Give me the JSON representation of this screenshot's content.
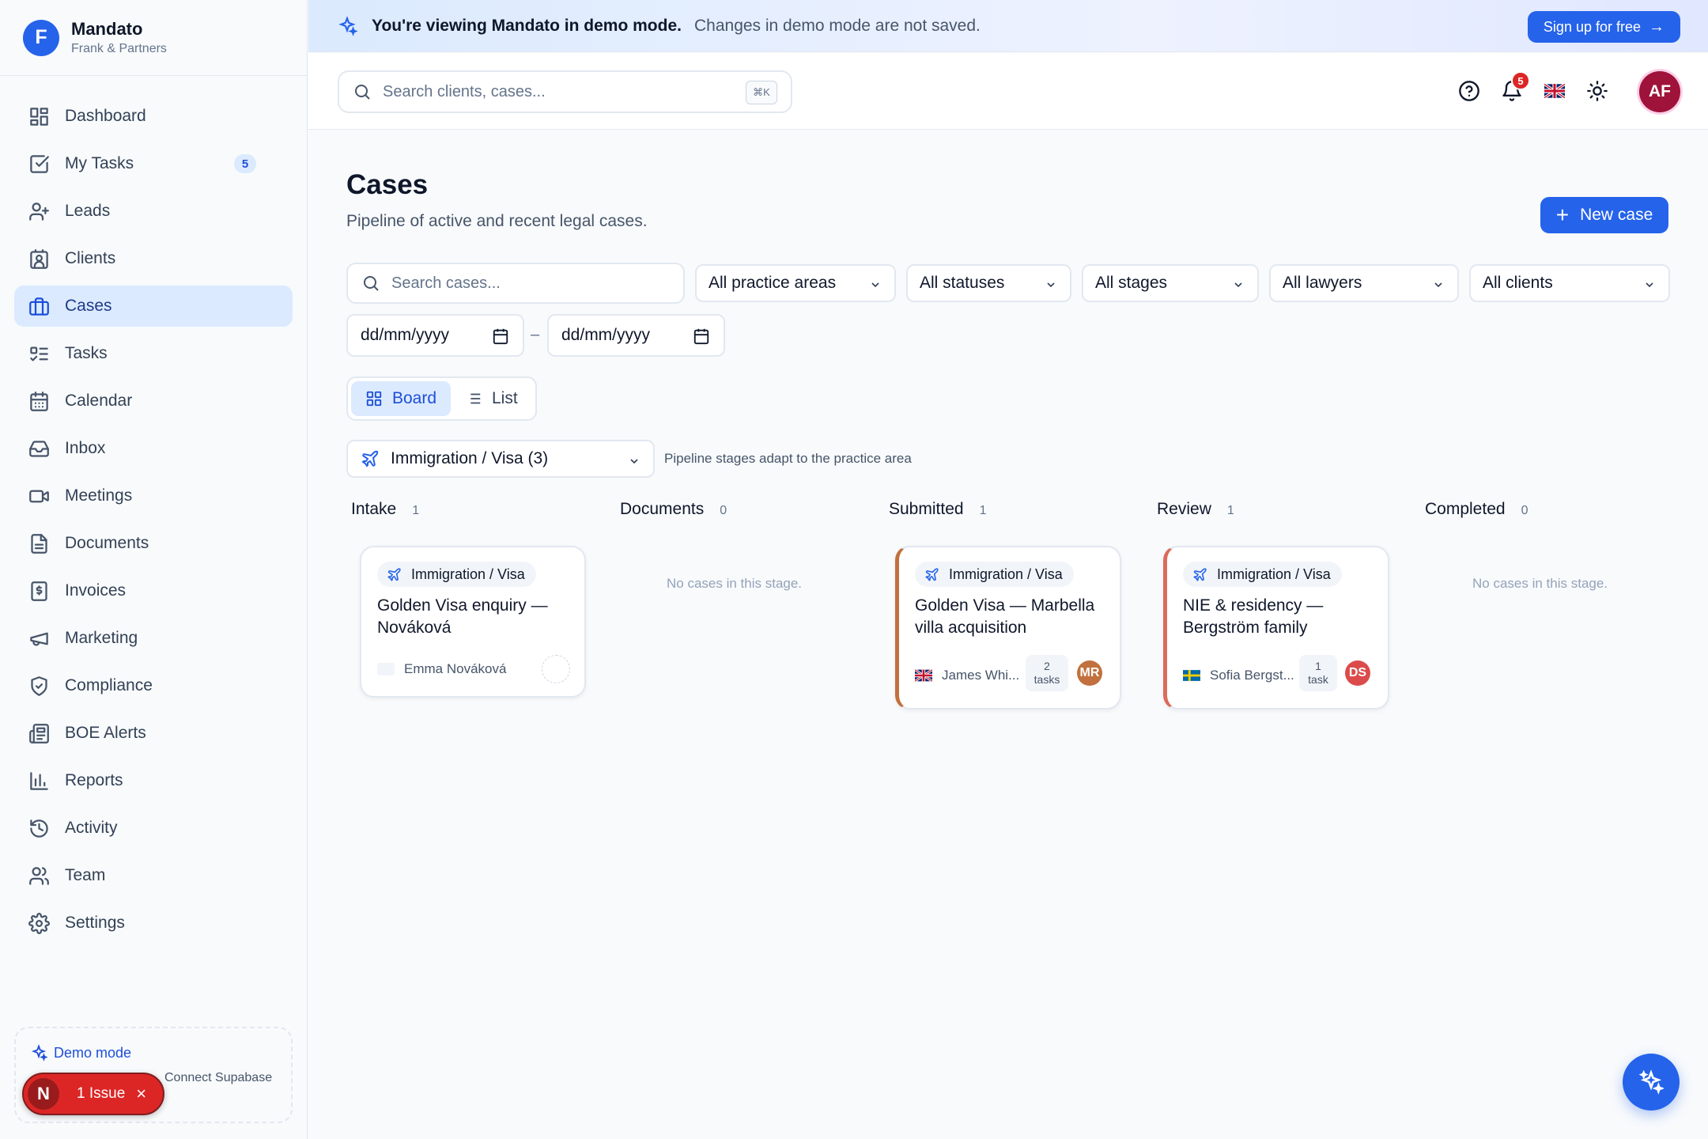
{
  "brand": {
    "initial": "F",
    "name": "Mandato",
    "firm": "Frank & Partners"
  },
  "sidebar": {
    "items": [
      {
        "label": "Dashboard",
        "icon": "dashboard-icon"
      },
      {
        "label": "My Tasks",
        "icon": "checkbox-icon",
        "badge": "5"
      },
      {
        "label": "Leads",
        "icon": "user-plus-icon"
      },
      {
        "label": "Clients",
        "icon": "contact-icon"
      },
      {
        "label": "Cases",
        "icon": "briefcase-icon",
        "active": true
      },
      {
        "label": "Tasks",
        "icon": "list-todo-icon"
      },
      {
        "label": "Calendar",
        "icon": "calendar-icon"
      },
      {
        "label": "Inbox",
        "icon": "inbox-icon"
      },
      {
        "label": "Meetings",
        "icon": "video-icon"
      },
      {
        "label": "Documents",
        "icon": "file-icon"
      },
      {
        "label": "Invoices",
        "icon": "invoice-icon"
      },
      {
        "label": "Marketing",
        "icon": "megaphone-icon"
      },
      {
        "label": "Compliance",
        "icon": "shield-icon"
      },
      {
        "label": "BOE Alerts",
        "icon": "newspaper-icon"
      },
      {
        "label": "Reports",
        "icon": "bar-chart-icon"
      },
      {
        "label": "Activity",
        "icon": "history-icon"
      },
      {
        "label": "Team",
        "icon": "users-icon"
      },
      {
        "label": "Settings",
        "icon": "gear-icon"
      }
    ],
    "demo": {
      "title": "Demo mode",
      "connect": "Connect Supabase"
    },
    "issue": {
      "initial": "N",
      "label": "1 Issue"
    }
  },
  "banner": {
    "strong": "You're viewing Mandato in demo mode.",
    "soft": "Changes in demo mode are not saved.",
    "signup": "Sign up for free"
  },
  "header": {
    "search_placeholder": "Search clients, cases...",
    "shortcut": "⌘K",
    "notifications": "5",
    "avatar": "AF"
  },
  "main": {
    "title": "Cases",
    "subtitle": "Pipeline of active and recent legal cases.",
    "new_case": "New case",
    "search_placeholder": "Search cases...",
    "filters": [
      "All practice areas",
      "All statuses",
      "All stages",
      "All lawyers",
      "All clients"
    ],
    "date_placeholder": "dd/mm/yyyy",
    "date_sep": "–",
    "view": {
      "board": "Board",
      "list": "List"
    },
    "practice_area": "Immigration / Visa (3)",
    "practice_hint": "Pipeline stages adapt to the practice area",
    "columns": [
      {
        "name": "Intake",
        "count": "1"
      },
      {
        "name": "Documents",
        "count": "0",
        "empty": "No cases in this stage."
      },
      {
        "name": "Submitted",
        "count": "1"
      },
      {
        "name": "Review",
        "count": "1"
      },
      {
        "name": "Completed",
        "count": "0",
        "empty": "No cases in this stage."
      }
    ],
    "cards": [
      {
        "tag": "Immigration / Visa",
        "title": "Golden Visa enquiry — Nováková",
        "client": "Emma Nováková"
      },
      {
        "tag": "Immigration / Visa",
        "title": "Golden Visa — Marbella villa acquisition",
        "client": "James Whi...",
        "tasks_count": "2",
        "tasks_word": "tasks",
        "avatar": "MR",
        "avatar_color": "#c2703d",
        "flag": "uk-flag-icon"
      },
      {
        "tag": "Immigration / Visa",
        "title": "NIE & residency — Bergström family",
        "client": "Sofia Bergst...",
        "tasks_count": "1",
        "tasks_word": "task",
        "avatar": "DS",
        "avatar_color": "#dc4b4b",
        "flag": "sweden-flag-icon"
      }
    ]
  }
}
